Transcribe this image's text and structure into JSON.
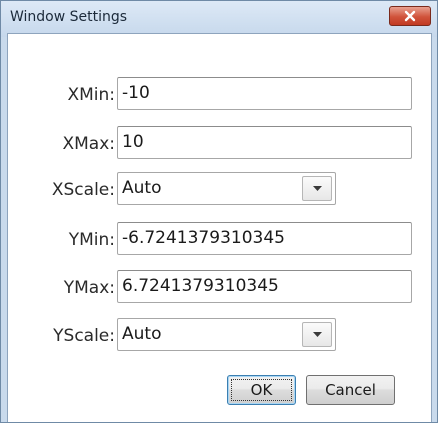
{
  "window": {
    "title": "Window Settings"
  },
  "fields": {
    "xmin": {
      "label": "XMin:",
      "value": "-10"
    },
    "xmax": {
      "label": "XMax:",
      "value": "10"
    },
    "xscale": {
      "label": "XScale:",
      "value": "Auto"
    },
    "ymin": {
      "label": "YMin:",
      "value": "-6.7241379310345"
    },
    "ymax": {
      "label": "YMax:",
      "value": "6.7241379310345"
    },
    "yscale": {
      "label": "YScale:",
      "value": "Auto"
    }
  },
  "buttons": {
    "ok": "OK",
    "cancel": "Cancel"
  },
  "icons": {
    "close": "close-icon",
    "dropdown": "chevron-down-icon"
  },
  "colors": {
    "close_button": "#c94a33",
    "titlebar": "#c9daec",
    "default_button_border": "#3c7fb1"
  }
}
